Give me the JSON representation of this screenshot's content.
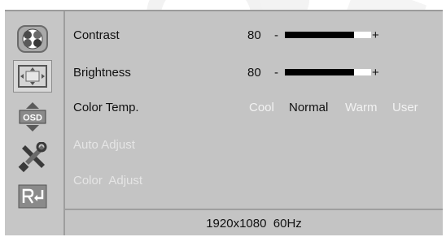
{
  "menu": {
    "sidebar_icons": [
      "color-wheel-icon",
      "image-position-icon",
      "osd-settings-icon",
      "tools-icon",
      "return-icon"
    ],
    "osd_icon_text": "OSD",
    "items": [
      {
        "label": "Contrast",
        "value": "80",
        "minus": "-",
        "plus": "+",
        "level": 0.8
      },
      {
        "label": "Brightness",
        "value": "80",
        "minus": "-",
        "plus": "+",
        "level": 0.8
      },
      {
        "label": "Color Temp.",
        "options": [
          "Cool",
          "Normal",
          "Warm",
          "User"
        ],
        "selected": "Normal"
      },
      {
        "label": "Auto Adjust",
        "enabled": false
      },
      {
        "label": "Color  Adjust",
        "enabled": false
      }
    ],
    "status": "1920x1080  60Hz"
  },
  "colors": {
    "panel_bg": "#c4c4c4",
    "bar_fill": "#000000",
    "bar_empty": "#ffffff",
    "highlight_text": "#f2f2f2"
  }
}
